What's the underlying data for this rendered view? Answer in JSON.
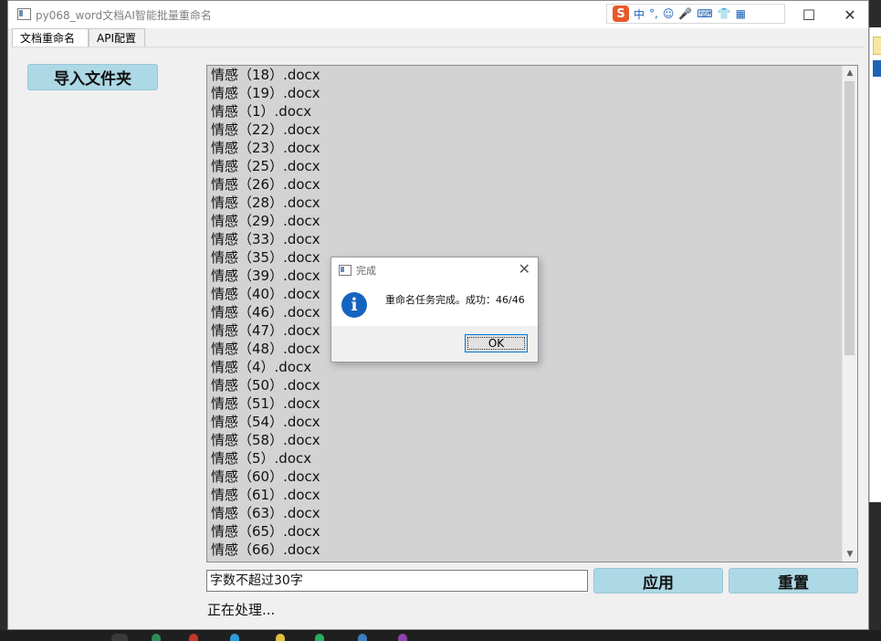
{
  "window": {
    "title": "py068_word文档AI智能批量重命名",
    "controls": {
      "minimize": "—",
      "maximize": "☐",
      "close": "✕"
    }
  },
  "ime_toolbar": {
    "logo": "S",
    "items": [
      "中",
      "°,",
      "☺",
      "🎤",
      "⌨",
      "👕",
      "▦"
    ]
  },
  "tabs": [
    {
      "label": "文档重命名",
      "active": true
    },
    {
      "label": "API配置",
      "active": false
    }
  ],
  "import_button": {
    "label": "导入文件夹"
  },
  "file_list": [
    "情感（18）.docx",
    "情感（19）.docx",
    "情感（1）.docx",
    "情感（22）.docx",
    "情感（23）.docx",
    "情感（25）.docx",
    "情感（26）.docx",
    "情感（28）.docx",
    "情感（29）.docx",
    "情感（33）.docx",
    "情感（35）.docx",
    "情感（39）.docx",
    "情感（40）.docx",
    "情感（46）.docx",
    "情感（47）.docx",
    "情感（48）.docx",
    "情感（4）.docx",
    "情感（50）.docx",
    "情感（51）.docx",
    "情感（54）.docx",
    "情感（58）.docx",
    "情感（5）.docx",
    "情感（60）.docx",
    "情感（61）.docx",
    "情感（63）.docx",
    "情感（65）.docx",
    "情感（66）.docx"
  ],
  "prompt_input": {
    "value": "字数不超过30字"
  },
  "apply_button": {
    "label": "应用"
  },
  "reset_button": {
    "label": "重置"
  },
  "status": {
    "text": "正在处理..."
  },
  "dialog": {
    "title": "完成",
    "message": "重命名任务完成。成功：46/46",
    "ok_label": "OK",
    "icon": "info-icon"
  },
  "colors": {
    "button_bg": "#add8e6",
    "list_bg": "#d3d3d3",
    "info_blue": "#1565c0"
  }
}
